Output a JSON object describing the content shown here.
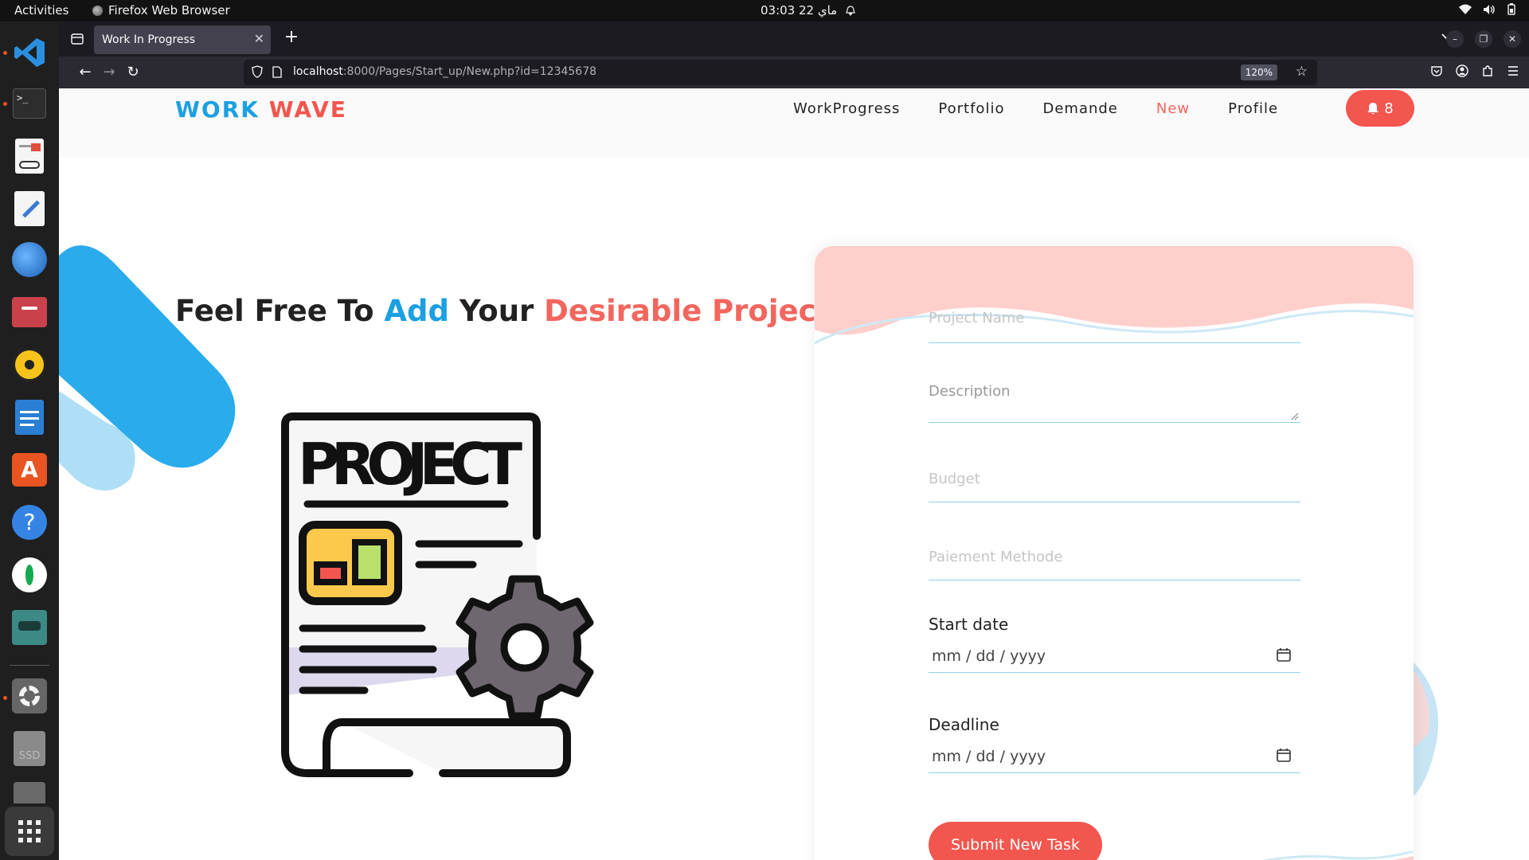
{
  "system_bar": {
    "activities": "Activities",
    "app_name": "Firefox Web Browser",
    "clock": "03:03  22 ماي"
  },
  "dock": {
    "apps": [
      "vscode-icon",
      "terminal-icon",
      "document-viewer-icon",
      "text-editor-icon",
      "thunderbird-icon",
      "files-icon",
      "rhythmbox-icon",
      "writer-icon",
      "app-center-icon",
      "help-icon",
      "mongodb-compass-icon",
      "mysql-workbench-icon",
      "settings-icon",
      "ssd-drive-icon",
      "drive-icon",
      "show-apps-icon"
    ],
    "ssd_label": "SSD"
  },
  "browser": {
    "tab_title": "Work In Progress",
    "url_host": "localhost",
    "url_rest": ":8000/Pages/Start_up/New.php?id=12345678",
    "zoom": "120%"
  },
  "site": {
    "logo_part1": "WORK",
    "logo_part2": "WAVE",
    "nav": {
      "work_progress": "WorkProgress",
      "portfolio": "Portfolio",
      "demande": "Demande",
      "new": "New",
      "profile": "Profile"
    },
    "notification_count": "8",
    "hero": {
      "part1": "Feel Free To ",
      "part2": "Add",
      "part3": " Your ",
      "part4": "Desirable Project"
    },
    "illustration_text": "PROJECT",
    "form": {
      "project_name_placeholder": "Project Name",
      "description_placeholder": "Description",
      "budget_placeholder": "Budget",
      "payment_placeholder": "Paiement Methode",
      "start_date_label": "Start date",
      "start_date_value": "mm / dd / yyyy",
      "deadline_label": "Deadline",
      "deadline_value": "mm / dd / yyyy",
      "submit_label": "Submit New Task"
    }
  },
  "colors": {
    "brand_blue": "#1ba0e2",
    "brand_red": "#f2564e",
    "field_underline": "#8fd3ec",
    "wave_pink": "#ffcfcc"
  }
}
